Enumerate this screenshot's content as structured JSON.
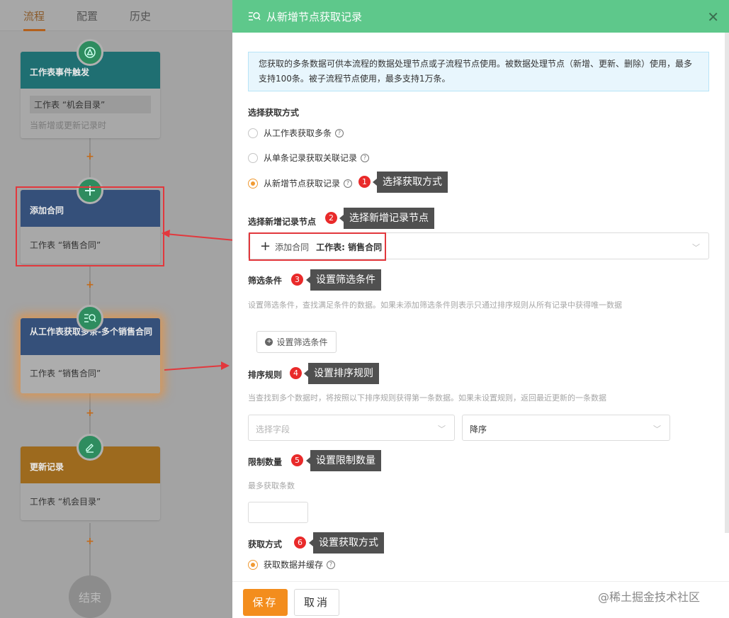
{
  "tabs": [
    "流程",
    "配置",
    "历史"
  ],
  "nodes": {
    "trigger": {
      "title": "工作表事件触发",
      "chip": "工作表 “机会目录”",
      "sub": "当新增或更新记录时"
    },
    "add": {
      "title": "添加合同",
      "body": "工作表 “销售合同”"
    },
    "get": {
      "title": "从工作表获取多条-多个销售合同",
      "body": "工作表 “销售合同”"
    },
    "update": {
      "title": "更新记录",
      "body": "工作表 “机会目录”"
    },
    "end": "结束",
    "plus": "+"
  },
  "drawer": {
    "title": "从新增节点获取记录",
    "info": "您获取的多条数据可供本流程的数据处理节点或子流程节点使用。被数据处理节点（新增、更新、删除）使用，最多支持100条。被子流程节点使用，最多支持1万条。",
    "method_label": "选择获取方式",
    "radios": [
      "从工作表获取多条",
      "从单条记录获取关联记录",
      "从新增节点获取记录"
    ],
    "node_label": "选择新增记录节点",
    "node_value_name": "添加合同",
    "node_value_sheet": "工作表: 销售合同",
    "filter_label": "筛选条件",
    "filter_desc": "设置筛选条件，查找满足条件的数据。如果未添加筛选条件则表示只通过排序规则从所有记录中获得唯一数据",
    "filter_button": "设置筛选条件",
    "sort_label": "排序规则",
    "sort_desc": "当查找到多个数据时，将按照以下排序规则获得第一条数据。如果未设置规则，返回最近更新的一条数据",
    "sort_field_placeholder": "选择字段",
    "sort_order": "降序",
    "limit_label": "限制数量",
    "limit_desc": "最多获取条数",
    "fetch_label": "获取方式",
    "fetch_option": "获取数据并缓存",
    "save": "保存",
    "cancel": "取消"
  },
  "callouts": [
    "选择获取方式",
    "选择新增记录节点",
    "设置筛选条件",
    "设置排序规则",
    "设置限制数量",
    "设置获取方式"
  ],
  "badges": [
    "1",
    "2",
    "3",
    "4",
    "5",
    "6"
  ],
  "watermark": "@稀土掘金技术社区",
  "colors": {
    "header": "#5ec88b",
    "accent": "#f38d1d",
    "annotation": "#e2383d"
  }
}
